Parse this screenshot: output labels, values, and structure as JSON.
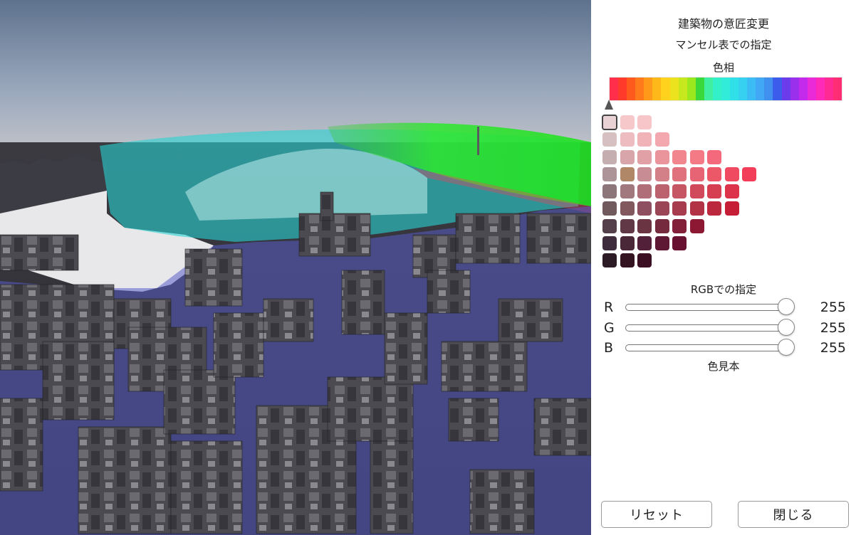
{
  "panel": {
    "title": "建築物の意匠変更",
    "munsell_label": "マンセル表での指定",
    "hue_label": "色相",
    "rgb_label": "RGBでの指定",
    "swatch_label": "色見本",
    "reset_label": "リセット",
    "close_label": "閉じる"
  },
  "hue_colors": [
    "#ff2e4a",
    "#ff3a2a",
    "#ff5a1e",
    "#ff7a1a",
    "#ff991a",
    "#ffb81a",
    "#ffd21e",
    "#ece21e",
    "#c8e81e",
    "#9ce81e",
    "#3ad83a",
    "#40f0a0",
    "#34f0c8",
    "#30ecd8",
    "#30e0e8",
    "#36d0f0",
    "#3cbcf4",
    "#40a8f4",
    "#4090f0",
    "#3c5cec",
    "#6a3cec",
    "#9a30ec",
    "#c42aec",
    "#ea2ad8",
    "#ff2ab8",
    "#ff2a94",
    "#ff2e74"
  ],
  "munsell_rows": [
    [
      "#e8d2d4",
      "#f6c8ca",
      "#f6c6c8"
    ],
    [
      "#d6c0c2",
      "#ecbcc0",
      "#f0b4b8",
      "#f2a8ae"
    ],
    [
      "#c4aeb0",
      "#d8a6aa",
      "#e0a0a6",
      "#ea949c",
      "#f2868e",
      "#f47a86",
      "#f46a7c"
    ],
    [
      "#ac9498",
      "#b08868",
      "#c88c94",
      "#d48088",
      "#e0727e",
      "#e66474",
      "#ec5868",
      "#f04a60",
      "#f23e58"
    ],
    [
      "#8c767a",
      "#a0787e",
      "#b06e78",
      "#bc626e",
      "#c65664",
      "#d04a5c",
      "#d63e52",
      "#dc324a"
    ],
    [
      "#705a5e",
      "#80585e",
      "#8e5060",
      "#9a4656",
      "#a63c4e",
      "#b23246",
      "#bc283e",
      "#c61e36"
    ],
    [
      "#54404a",
      "#603846",
      "#6a3442",
      "#762a3e",
      "#82203a",
      "#8c1834"
    ],
    [
      "#3e2c3c",
      "#4a2838",
      "#522038",
      "#5e1834",
      "#681030"
    ],
    [
      "#2c1a24",
      "#341420",
      "#3c0e22"
    ]
  ],
  "rgb": {
    "r_label": "R",
    "g_label": "G",
    "b_label": "B",
    "r": 255,
    "g": 255,
    "b": 255
  }
}
